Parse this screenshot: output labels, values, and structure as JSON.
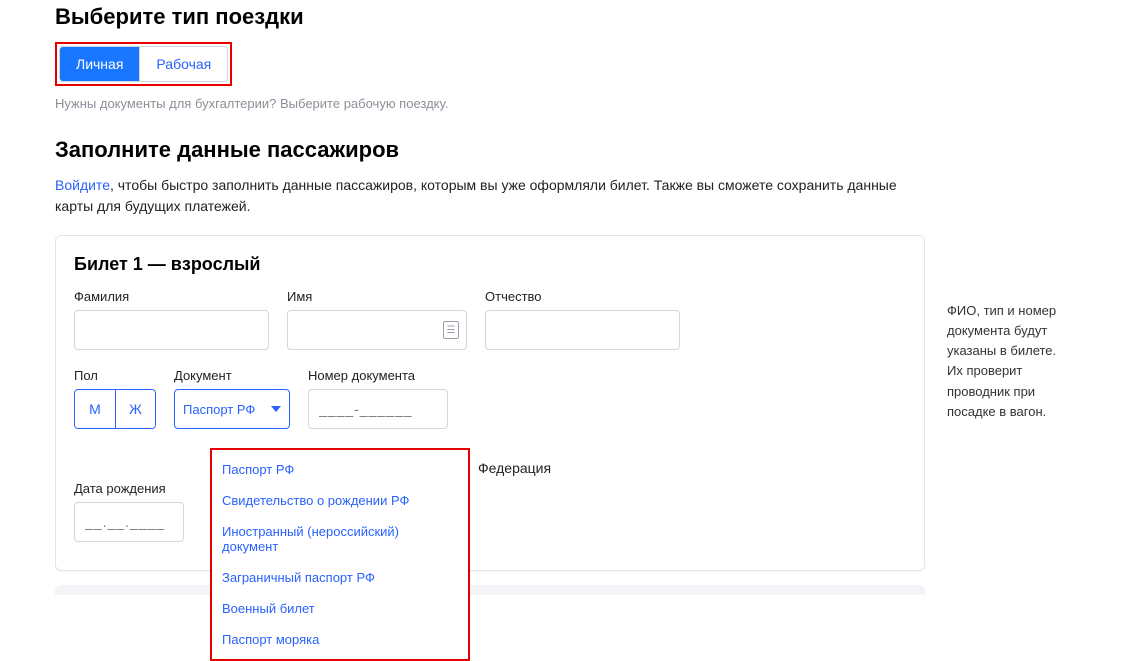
{
  "tripType": {
    "heading": "Выберите тип поездки",
    "options": {
      "personal": "Личная",
      "work": "Рабочая"
    },
    "hint": "Нужны документы для бухгалтерии? Выберите рабочую поездку."
  },
  "passengers": {
    "heading": "Заполните данные пассажиров",
    "loginLink": "Войдите",
    "loginTail": ", чтобы быстро заполнить данные пассажиров, которым вы уже оформляли билет. Также вы сможете сохранить данные карты для будущих платежей."
  },
  "ticket": {
    "title": "Билет 1 — взрослый",
    "labels": {
      "surname": "Фамилия",
      "name": "Имя",
      "patronymic": "Отчество",
      "gender": "Пол",
      "document": "Документ",
      "documentNumber": "Номер документа",
      "dob": "Дата рождения"
    },
    "gender": {
      "m": "М",
      "f": "Ж"
    },
    "docSelected": "Паспорт РФ",
    "docNumberMask": "____-______",
    "dobMask": "__.__.____",
    "countryLabelTail": "Федерация",
    "docOptions": [
      "Паспорт РФ",
      "Свидетельство о рождении РФ",
      "Иностранный (нероссийский) документ",
      "Заграничный паспорт РФ",
      "Военный билет",
      "Паспорт моряка"
    ]
  },
  "sideHelp": "ФИО, тип и номер документа будут указаны в билете. Их проверит проводник при посадке в вагон."
}
